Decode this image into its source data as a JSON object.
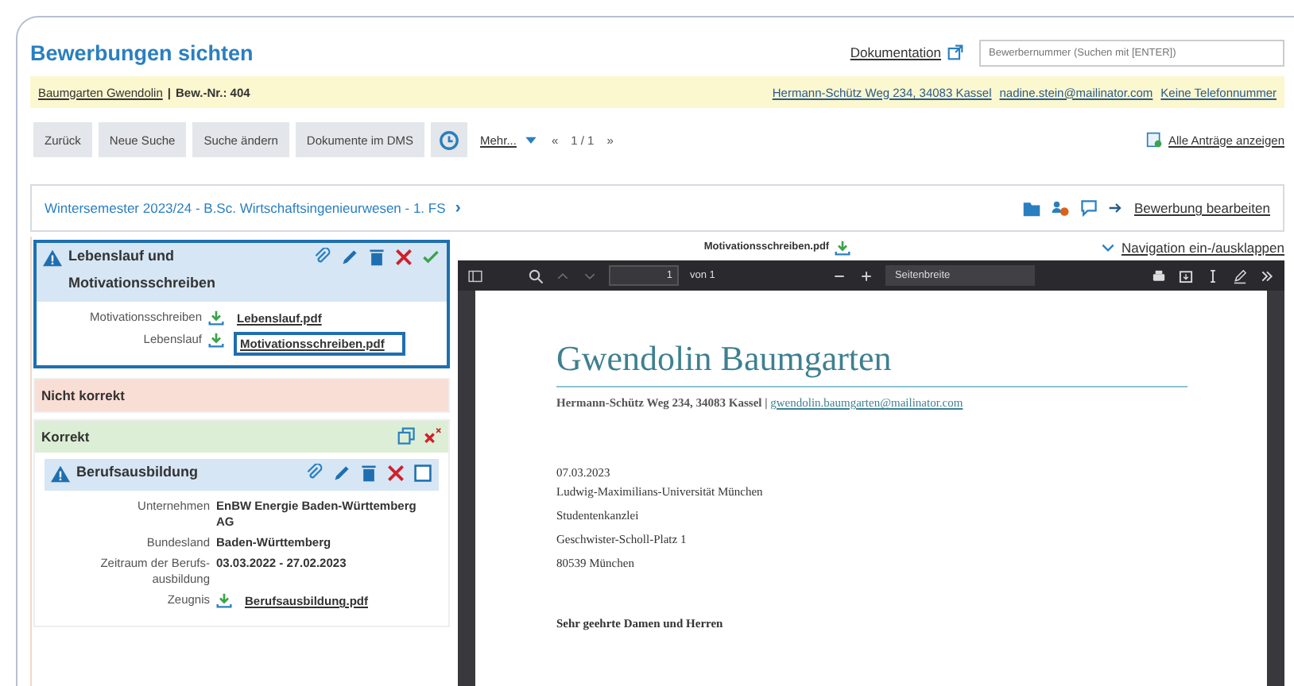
{
  "page_title": "Bewerbungen sichten",
  "documentation_link": "Dokumentation",
  "search": {
    "placeholder": "Bewerbernummer (Suchen mit [ENTER])"
  },
  "applicant": {
    "name": "Baumgarten Gwendolin",
    "separator": "|",
    "number": "Bew.-Nr.: 404",
    "address": "Hermann-Schütz Weg 234, 34083 Kassel",
    "email": "nadine.stein@mailinator.com",
    "phone": "Keine Telefonnummer"
  },
  "toolbar": {
    "buttons": [
      "Zurück",
      "Neue Suche",
      "Suche ändern",
      "Dokumente im DMS"
    ],
    "more": "Mehr...",
    "first": "«",
    "pager": "1 / 1",
    "last": "»",
    "all_applications": "Alle Anträge anzeigen"
  },
  "program": {
    "title": "Wintersemester 2023/24 - B.Sc. Wirtschaftsingenieurwesen - 1. FS",
    "chevron": "›",
    "edit_link": "Bewerbung bearbeiten"
  },
  "sections": [
    {
      "kind": "plain",
      "cards": [
        {
          "title": "Lebenslauf und Motivationsschreiben",
          "selected": true,
          "confirmed": true,
          "fields": [
            {
              "kind": "file",
              "label": "Motivationsschreiben",
              "value": "Lebenslauf.pdf",
              "selected": false
            },
            {
              "kind": "file",
              "label": "Lebenslauf",
              "value": "Motivationsschreiben.pdf",
              "selected": true
            }
          ]
        }
      ]
    },
    {
      "kind": "bad",
      "title": "Nicht korrekt"
    },
    {
      "kind": "good",
      "title": "Korrekt",
      "cards": [
        {
          "title": "Berufsausbildung",
          "selected": false,
          "confirmed": false,
          "fields": [
            {
              "kind": "text",
              "label": "Unternehmen",
              "value": "EnBW Energie Baden-Württemberg AG"
            },
            {
              "kind": "text",
              "label": "Bundesland",
              "value": "Baden-Württemberg"
            },
            {
              "kind": "text",
              "label": "Zeitraum der Berufs-ausbildung",
              "value": "03.03.2022 - 27.02.2023"
            },
            {
              "kind": "file",
              "label": "Zeugnis",
              "value": "Berufsausbildung.pdf",
              "selected": false
            }
          ]
        }
      ]
    }
  ],
  "viewer": {
    "filename": "Motivationsschreiben.pdf",
    "nav_toggle": "Navigation ein-/ausklappen",
    "page": "1",
    "page_count": "von 1",
    "zoom": "Seitenbreite",
    "document": {
      "name": "Gwendolin Baumgarten",
      "address": "Hermann-Schütz Weg 234, 34083 Kassel |",
      "email": "gwendolin.baumgarten@mailinator.com",
      "date": "07.03.2023",
      "recipient": [
        "Ludwig-Maximilians-Universität München",
        "Studentenkanzlei",
        "Geschwister-Scholl-Platz 1",
        "80539 München"
      ],
      "salutation": "Sehr geehrte Damen und Herren"
    }
  }
}
